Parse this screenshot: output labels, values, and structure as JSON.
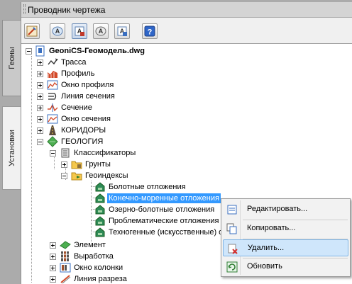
{
  "sidebar": {
    "tabs": [
      {
        "label": "Геоны",
        "active": false
      },
      {
        "label": "Установки",
        "active": true
      }
    ]
  },
  "panel": {
    "title": "Проводник чертежа"
  },
  "toolbar": {
    "buttons": [
      {
        "icon": "draw-edit-icon"
      },
      {
        "icon": "text-style-a-icon"
      },
      {
        "icon": "text-style-table-icon"
      },
      {
        "icon": "text-style-b-icon"
      },
      {
        "icon": "text-style-grid-icon"
      },
      {
        "icon": "help-icon",
        "label": "?"
      }
    ]
  },
  "tree": {
    "root": "GeoniCS-Геомодель.dwg",
    "items": [
      "Трасса",
      "Профиль",
      "Окно профиля",
      "Линия сечения",
      "Сечение",
      "Окно сечения",
      "КОРИДОРЫ",
      "ГЕОЛОГИЯ",
      "Классификаторы",
      "Грунты",
      "Геоиндексы",
      "Болотные отложения",
      "Конечно-моренные отложения",
      "Озерно-болотные отложения",
      "Проблематические отложения",
      "Техногенные (искусственные) о",
      "Элемент",
      "Выработка",
      "Окно колонки",
      "Линия разреза"
    ],
    "selected": "Конечно-моренные отложения"
  },
  "context_menu": {
    "items": [
      {
        "label": "Редактировать...",
        "icon": "edit-icon"
      },
      {
        "label": "Копировать...",
        "icon": "copy-icon"
      },
      {
        "label": "Удалить...",
        "icon": "delete-icon",
        "highlighted": true
      },
      {
        "label": "Обновить",
        "icon": "refresh-icon"
      }
    ]
  },
  "colors": {
    "selection": "#3399ff",
    "menu_hover": "#cfe6fb"
  }
}
